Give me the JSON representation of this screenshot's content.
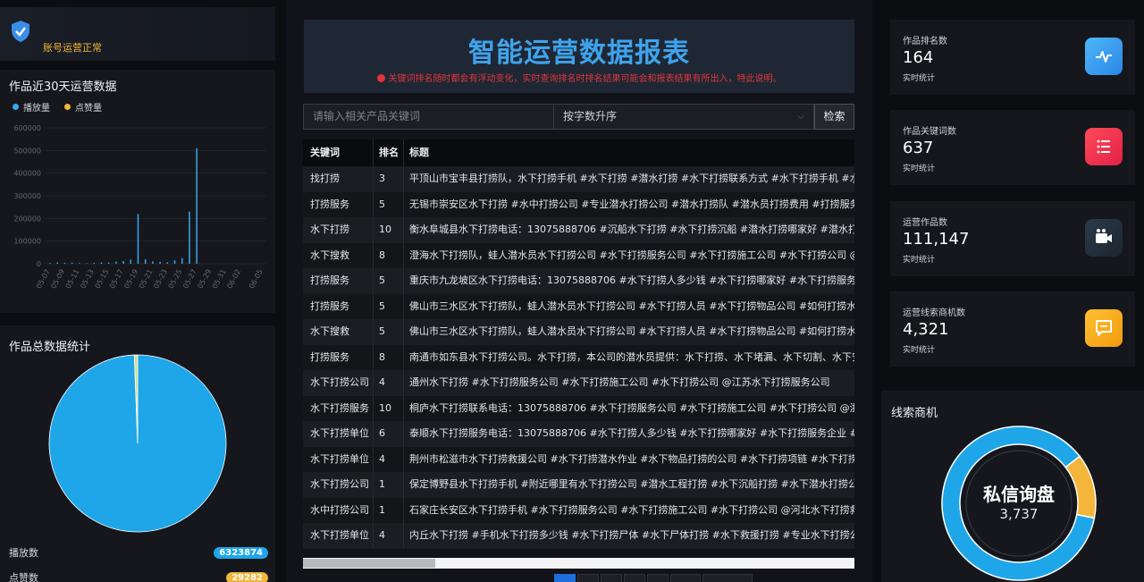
{
  "status": {
    "label": "账号运营正常"
  },
  "trend": {
    "title": "作品近30天运营数据",
    "legend": [
      {
        "name": "播放量",
        "color": "#3aa6ee"
      },
      {
        "name": "点赞量",
        "color": "#f3b53a"
      }
    ]
  },
  "totals": {
    "title": "作品总数据统计",
    "rows": [
      {
        "label": "播放数",
        "value": "6323874",
        "color": "#1fa6e8"
      },
      {
        "label": "点赞数",
        "value": "29282",
        "color": "#f3b53a"
      }
    ]
  },
  "banner": {
    "title": "智能运营数据报表",
    "note": "关键词排名随时都会有浮动变化，实时查询排名时排名结果可能会和报表结果有所出入，特此说明。"
  },
  "search": {
    "placeholder": "请输入相关产品关键词",
    "sort": "按字数升序",
    "button": "检索"
  },
  "table": {
    "headers": [
      "关键词",
      "排名",
      "标题"
    ],
    "rows": [
      {
        "keyword": "找打捞",
        "rank": "3",
        "title": "平顶山市宝丰县打捞队，水下打捞手机 #水下打捞 #潜水打捞 #水下打捞联系方式 #水下打捞手机 #水下"
      },
      {
        "keyword": "打捞服务",
        "rank": "5",
        "title": "无锡市崇安区水下打捞 #水中打捞公司 #专业潜水打捞公司 #潜水打捞队 #潜水员打捞费用 #打捞服务 @"
      },
      {
        "keyword": "水下打捞",
        "rank": "10",
        "title": "衡水阜城县水下打捞电话：13075888706 #沉船水下打捞 #水下打捞沉船 #潜水打捞哪家好 #潜水打捞"
      },
      {
        "keyword": "水下搜救",
        "rank": "8",
        "title": "澄海水下打捞队，蛙人潜水员水下打捞公司 #水下打捞服务公司 #水下打捞施工公司 #水下打捞公司 @广"
      },
      {
        "keyword": "打捞服务",
        "rank": "5",
        "title": "重庆市九龙坡区水下打捞电话：13075888706 #水下打捞人多少钱 #水下打捞哪家好 #水下打捞服务企业"
      },
      {
        "keyword": "打捞服务",
        "rank": "5",
        "title": "佛山市三水区水下打捞队，蛙人潜水员水下打捞公司 #水下打捞人员 #水下打捞物品公司 #如何打捞水下"
      },
      {
        "keyword": "水下搜救",
        "rank": "5",
        "title": "佛山市三水区水下打捞队，蛙人潜水员水下打捞公司 #水下打捞人员 #水下打捞物品公司 #如何打捞水下"
      },
      {
        "keyword": "打捞服务",
        "rank": "8",
        "title": "南通市如东县水下打捞公司。水下打捞，本公司的潜水员提供：水下打捞、水下堵漏、水下切割、水下安"
      },
      {
        "keyword": "水下打捞公司",
        "rank": "4",
        "title": "通州水下打捞 #水下打捞服务公司 #水下打捞施工公司 #水下打捞公司 @江苏水下打捞服务公司"
      },
      {
        "keyword": "水下打捞服务",
        "rank": "10",
        "title": "桐庐水下打捞联系电话：13075888706 #水下打捞服务公司 #水下打捞施工公司 #水下打捞公司 @浙江"
      },
      {
        "keyword": "水下打捞单位",
        "rank": "6",
        "title": "泰顺水下打捞服务电话：13075888706 #水下打捞人多少钱 #水下打捞哪家好 #水下打捞服务企业 #水下"
      },
      {
        "keyword": "水下打捞单位",
        "rank": "4",
        "title": "荆州市松滋市水下打捞救援公司 #水下打捞潜水作业 #水下物品打捞的公司 #水下打捞项链 #水下打捞工"
      },
      {
        "keyword": "水下打捞公司",
        "rank": "1",
        "title": "保定博野县水下打捞手机 #附近哪里有水下打捞公司 #潜水工程打捞 #水下沉船打捞 #水下潜水打捞公司"
      },
      {
        "keyword": "水中打捞公司",
        "rank": "1",
        "title": "石家庄长安区水下打捞手机 #水下打捞服务公司 #水下打捞施工公司 #水下打捞公司 @河北水下打捞救援"
      },
      {
        "keyword": "水下打捞单位",
        "rank": "4",
        "title": "内丘水下打捞 #手机水下打捞多少钱 #水下打捞尸体 #水下尸体打捞 #水下救援打捞 #专业水下打捞公司"
      }
    ]
  },
  "kpis": [
    {
      "label": "作品排名数",
      "value": "164",
      "sub": "实时统计",
      "icon": "pulse-icon",
      "color": "#3aa0f0"
    },
    {
      "label": "作品关键词数",
      "value": "637",
      "sub": "实时统计",
      "icon": "list-icon",
      "color": "#f2334f"
    },
    {
      "label": "运营作品数",
      "value": "111,147",
      "sub": "实时统计",
      "icon": "video-camera-icon",
      "color": "#23303c"
    },
    {
      "label": "运营线索商机数",
      "value": "4,321",
      "sub": "实时统计",
      "icon": "chat-icon",
      "color": "#f5a91a"
    }
  ],
  "leads": {
    "title": "线索商机",
    "center_title": "私信询盘",
    "center_value": "3,737"
  },
  "chart_data": [
    {
      "type": "bar",
      "categories": [
        "05-07",
        "05-08",
        "05-09",
        "05-10",
        "05-11",
        "05-12",
        "05-13",
        "05-14",
        "05-15",
        "05-16",
        "05-17",
        "05-18",
        "05-19",
        "05-20",
        "05-21",
        "05-22",
        "05-23",
        "05-24",
        "05-25",
        "05-26",
        "05-27",
        "05-28",
        "05-29",
        "05-30",
        "05-31",
        "06-01",
        "06-02",
        "06-03",
        "06-04",
        "06-05"
      ],
      "xtick_labels": [
        "05-07",
        "05-09",
        "05-11",
        "05-13",
        "05-15",
        "05-17",
        "05-19",
        "05-21",
        "05-23",
        "05-25",
        "05-27",
        "05-29",
        "05-31",
        "06-02",
        "06-05"
      ],
      "series": [
        {
          "name": "播放量",
          "color": "#3aa6ee",
          "values": [
            3000,
            6000,
            4000,
            5000,
            3000,
            2000,
            4000,
            6000,
            5000,
            9000,
            12000,
            18000,
            220000,
            20000,
            10000,
            8000,
            6000,
            15000,
            25000,
            230000,
            510000,
            0,
            0,
            0,
            0,
            0,
            0,
            0,
            0,
            0
          ]
        },
        {
          "name": "点赞量",
          "color": "#f3b53a",
          "values": [
            0,
            0,
            0,
            0,
            0,
            0,
            0,
            0,
            0,
            0,
            0,
            0,
            0,
            0,
            0,
            0,
            0,
            0,
            0,
            0,
            0,
            0,
            0,
            0,
            0,
            0,
            0,
            0,
            0,
            0
          ]
        }
      ],
      "ylim": [
        0,
        600000
      ],
      "yticks": [
        0,
        100000,
        200000,
        300000,
        400000,
        500000,
        600000
      ]
    },
    {
      "type": "pie",
      "labels": [
        "播放数",
        "点赞数"
      ],
      "values": [
        6323874,
        29282
      ],
      "colors": [
        "#1fa6e8",
        "#d8dd8a"
      ]
    },
    {
      "type": "pie",
      "labels": [
        "私信询盘",
        "other"
      ],
      "values": [
        3737,
        584
      ],
      "colors": [
        "#1fa6e8",
        "#f3b53a"
      ]
    }
  ]
}
